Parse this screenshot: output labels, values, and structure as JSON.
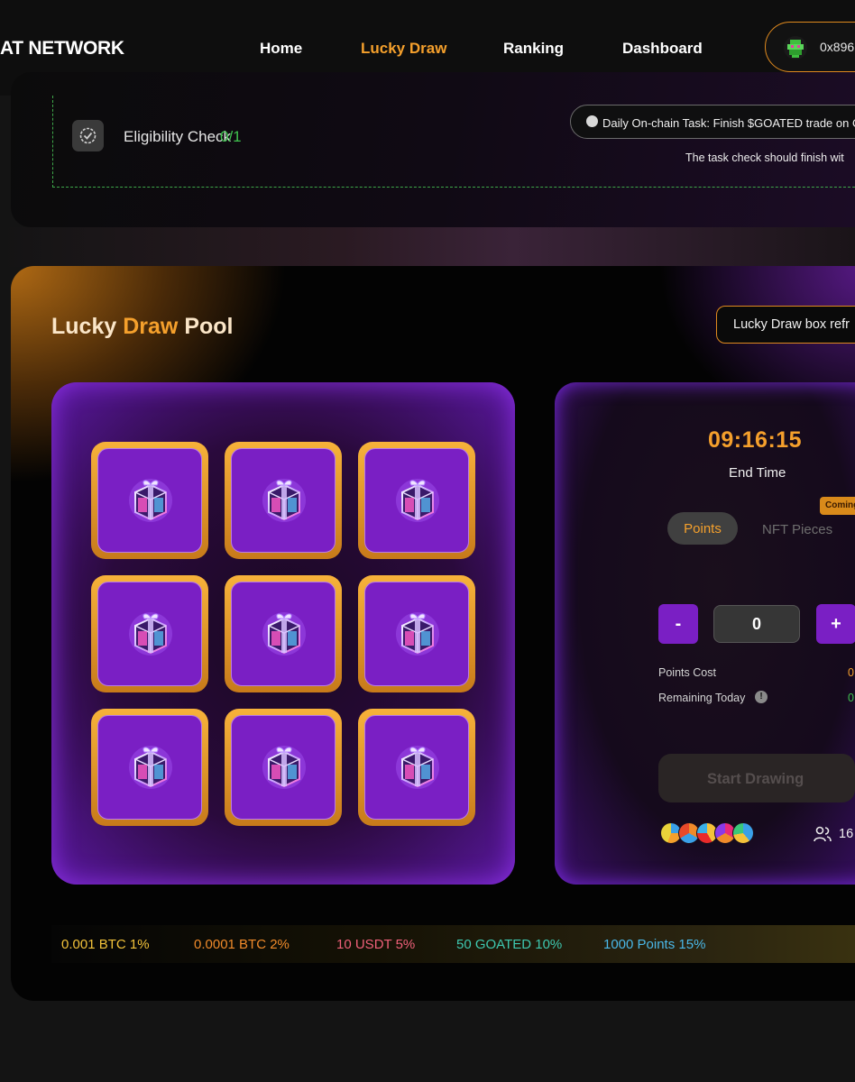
{
  "nav": {
    "brand": "AT NETWORK",
    "links": [
      "Home",
      "Lucky Draw",
      "Ranking",
      "Dashboard"
    ],
    "active": "Lucky Draw",
    "wallet_address": "0x896"
  },
  "eligibility": {
    "label": "Eligibility Check",
    "count": "0/1",
    "task": "Daily On-chain Task: Finish $GOATED trade on O",
    "note": "The task check should finish wit"
  },
  "pool": {
    "title_words": [
      "Lucky",
      "Draw",
      "Pool"
    ],
    "refresh_label": "Lucky Draw box refr",
    "tile_count": 9,
    "timer": "09:16:15",
    "end_time_label": "End Time",
    "coming_badge": "Coming",
    "tabs": [
      "Points",
      "NFT Pieces"
    ],
    "active_tab": "Points",
    "minus_label": "-",
    "plus_label": "+",
    "quantity": "0",
    "points_cost_label": "Points Cost",
    "points_cost_value": "0",
    "remaining_label": "Remaining Today",
    "remaining_value": "0",
    "start_label": "Start Drawing",
    "participants": "16"
  },
  "prizes": [
    {
      "label": "0.001 BTC 1%",
      "color": "#f2c23a"
    },
    {
      "label": "0.0001 BTC 2%",
      "color": "#f08a2a"
    },
    {
      "label": "10 USDT 5%",
      "color": "#f0607a"
    },
    {
      "label": "50 GOATED 10%",
      "color": "#3ec8b0"
    },
    {
      "label": "1000 Points 15%",
      "color": "#4ab8e8"
    }
  ],
  "colors": {
    "accent": "#f5a02c",
    "purple": "#7a1fc4",
    "success": "#3ec24e"
  }
}
